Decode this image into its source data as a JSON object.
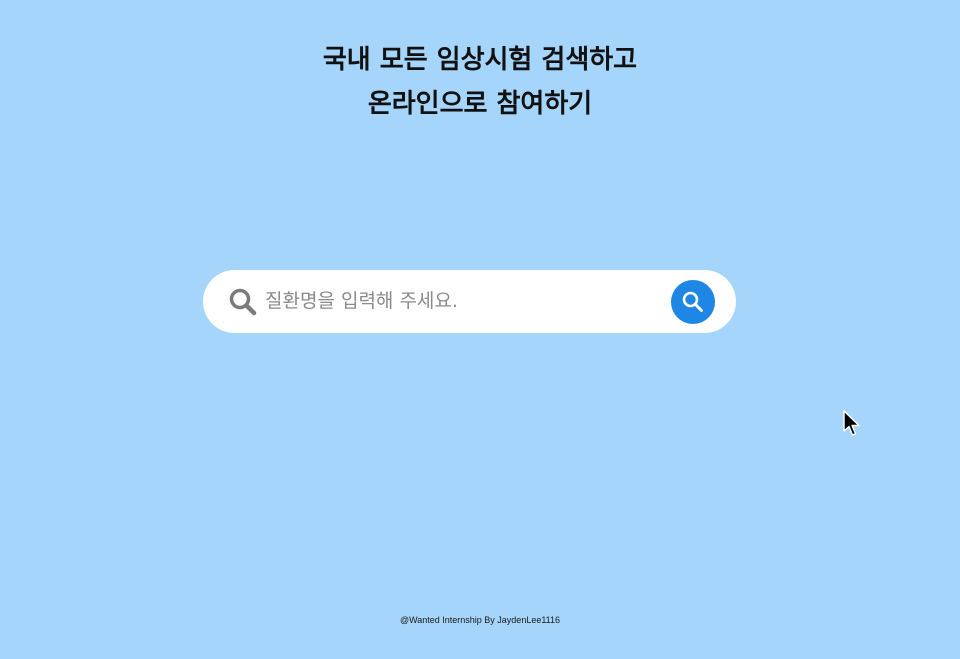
{
  "headline": {
    "line1": "국내 모든 임상시험 검색하고",
    "line2": "온라인으로 참여하기"
  },
  "search": {
    "placeholder": "질환명을 입력해 주세요.",
    "value": "",
    "leading_icon": "search-icon",
    "button_icon": "search-icon"
  },
  "footer": {
    "text": "@Wanted Internship By JaydenLee1116"
  },
  "colors": {
    "background": "#a6d5fb",
    "accent": "#1e86e4",
    "search_bar": "#ffffff"
  }
}
